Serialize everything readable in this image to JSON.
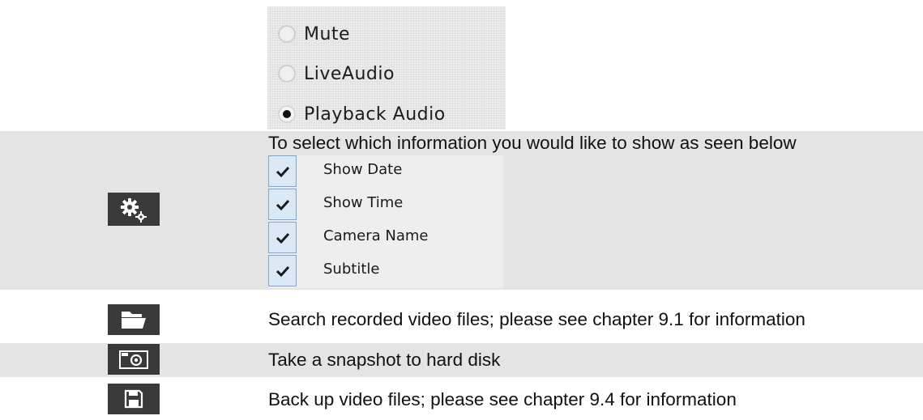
{
  "audio_options": [
    {
      "label": "Mute",
      "selected": false
    },
    {
      "label": "LiveAudio",
      "selected": false
    },
    {
      "label": "Playback Audio",
      "selected": true
    }
  ],
  "settings_row": {
    "icon": "gears-icon",
    "description": "To select which information you would like to show as seen below",
    "options": [
      {
        "label": "Show Date",
        "checked": true
      },
      {
        "label": "Show Time",
        "checked": true
      },
      {
        "label": "Camera Name",
        "checked": true
      },
      {
        "label": "Subtitle",
        "checked": true
      }
    ]
  },
  "search_row": {
    "icon": "folder-icon",
    "description": "Search recorded video files; please see chapter 9.1 for information"
  },
  "snapshot_row": {
    "icon": "camera-icon",
    "description": "Take a snapshot to hard disk"
  },
  "backup_row": {
    "icon": "floppy-disk-icon",
    "description": "Back up video files; please see chapter 9.4 for information"
  },
  "colors": {
    "row_gray": "#e4e4e4",
    "icon_bg": "#3a3a3a",
    "checkbox_border": "#7aa6d6",
    "checkbox_fill": "#dbe8f6"
  }
}
